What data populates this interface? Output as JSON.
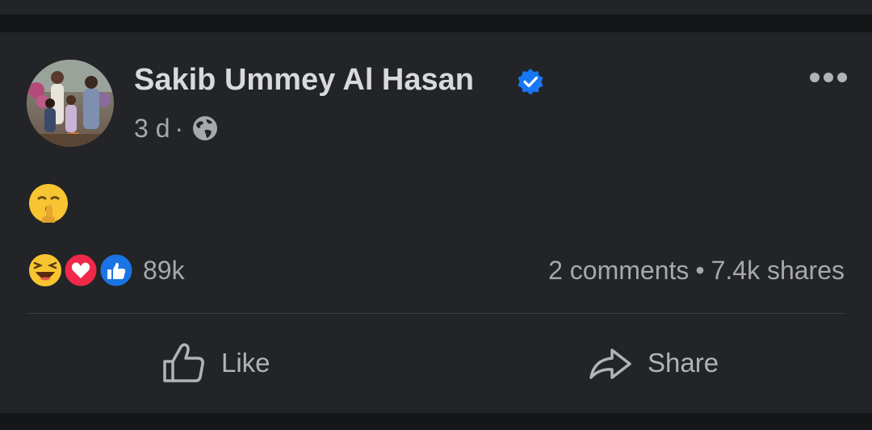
{
  "post": {
    "author": "Sakib Ummey Al Hasan",
    "verified": true,
    "time": "3 d",
    "separator": "·",
    "audience_icon": "globe-icon",
    "content_emoji": "shushing-face"
  },
  "engagement": {
    "reaction_types": [
      "haha",
      "love",
      "like"
    ],
    "reaction_count": "89k",
    "comments": "2 comments",
    "dot": "•",
    "shares": "7.4k shares"
  },
  "actions": {
    "like_label": "Like",
    "share_label": "Share"
  },
  "colors": {
    "background": "#1c1d1f",
    "card": "#232427",
    "verified_blue": "#1877f2",
    "like_blue": "#1b74e4",
    "love_red": "#f02849",
    "haha_yellow": "#f7c531"
  }
}
